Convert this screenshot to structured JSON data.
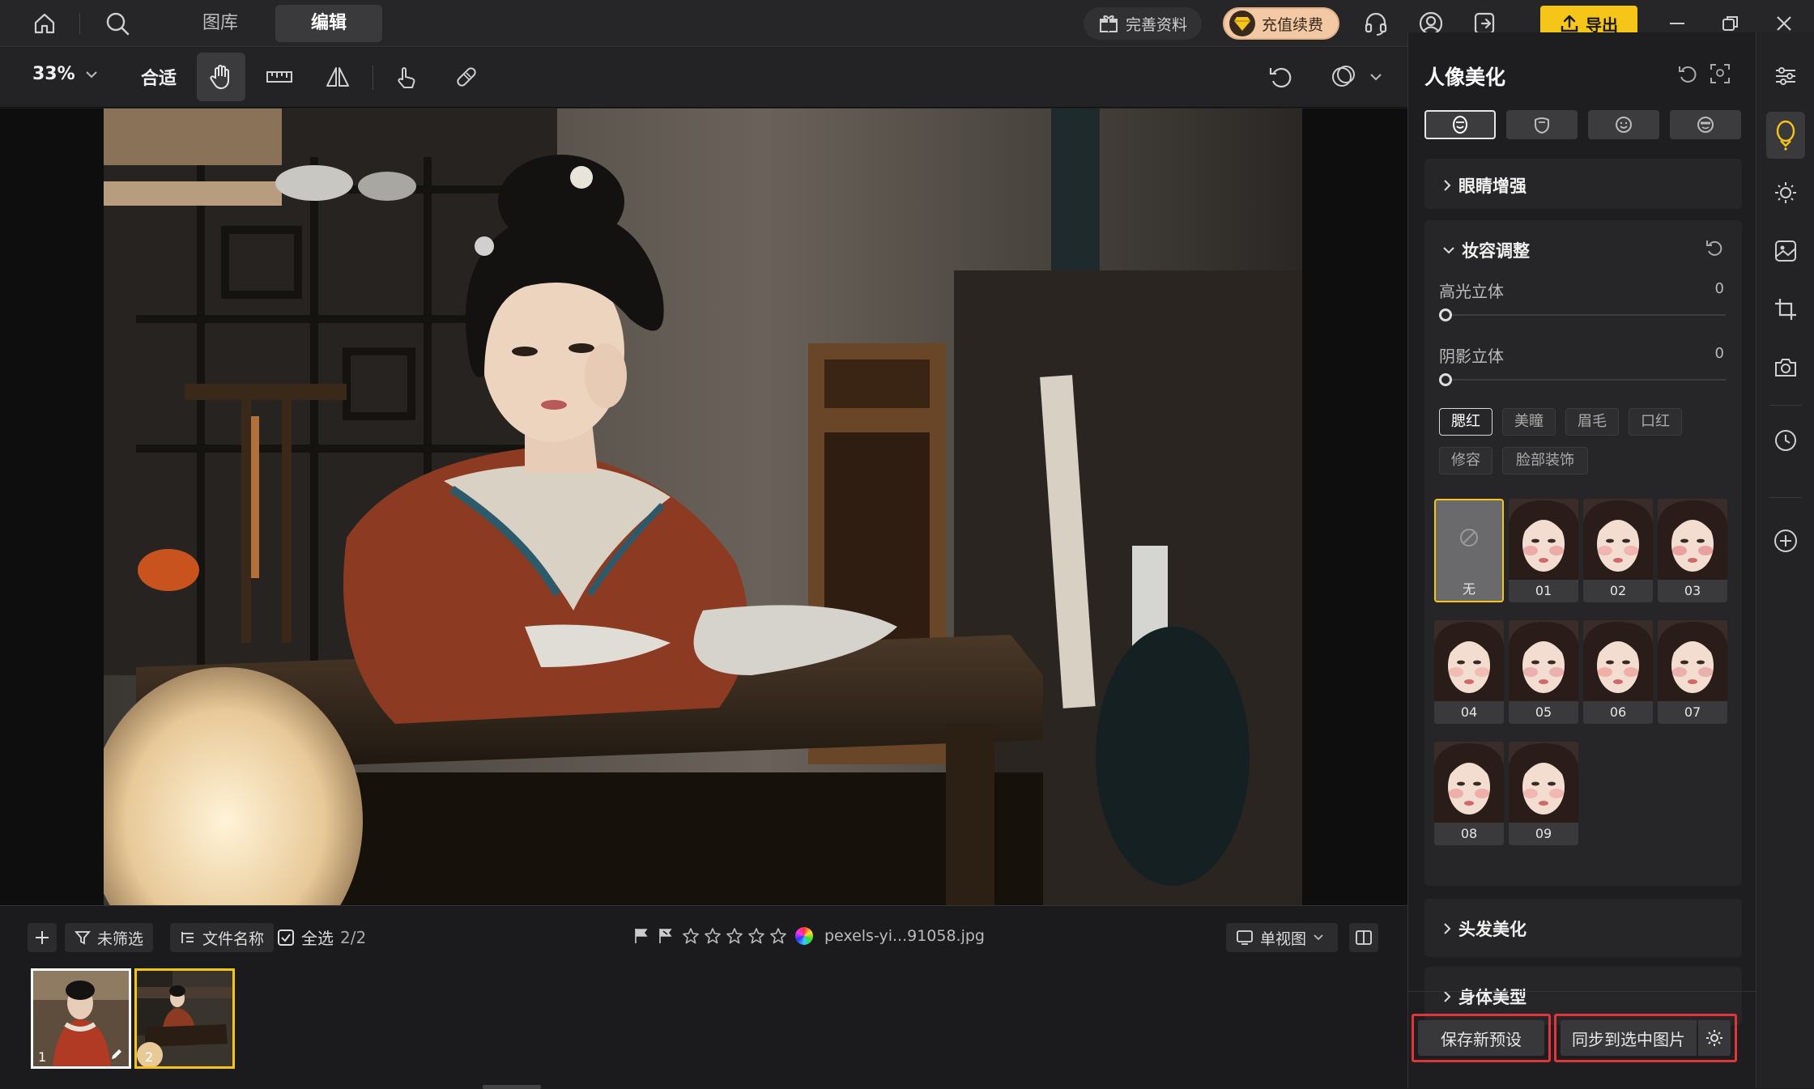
{
  "top_nav": {
    "tabs": [
      {
        "label": "图库"
      },
      {
        "label": "编辑"
      }
    ],
    "profile_button": "完善资料",
    "recharge_button": "充值续费",
    "export_button": "导出"
  },
  "toolbar": {
    "zoom": "33%",
    "fit_label": "合适"
  },
  "panel": {
    "title": "人像美化",
    "sections": {
      "eye": "眼睛增强",
      "makeup": "妆容调整",
      "hair": "头发美化",
      "body": "身体美型"
    },
    "sliders": [
      {
        "label": "高光立体",
        "value": "0"
      },
      {
        "label": "阴影立体",
        "value": "0"
      }
    ],
    "makeup_tabs": [
      "腮红",
      "美瞳",
      "眉毛",
      "口红",
      "修容",
      "脸部装饰"
    ],
    "presets": [
      "无",
      "01",
      "02",
      "03",
      "04",
      "05",
      "06",
      "07",
      "08",
      "09"
    ],
    "save_preset_button": "保存新预设",
    "sync_button": "同步到选中图片"
  },
  "filmstrip": {
    "filter_label": "未筛选",
    "sort_label": "文件名称",
    "select_all_label": "全选",
    "count": "2/2",
    "filename": "pexels-yi...91058.jpg",
    "view_label": "单视图",
    "rating_stars": 5,
    "thumbs": [
      "1",
      "2"
    ]
  },
  "colors": {
    "accent_yellow": "#f5c518",
    "highlight_red": "#e0353b",
    "recharge_bg": "#f2c9a4"
  }
}
